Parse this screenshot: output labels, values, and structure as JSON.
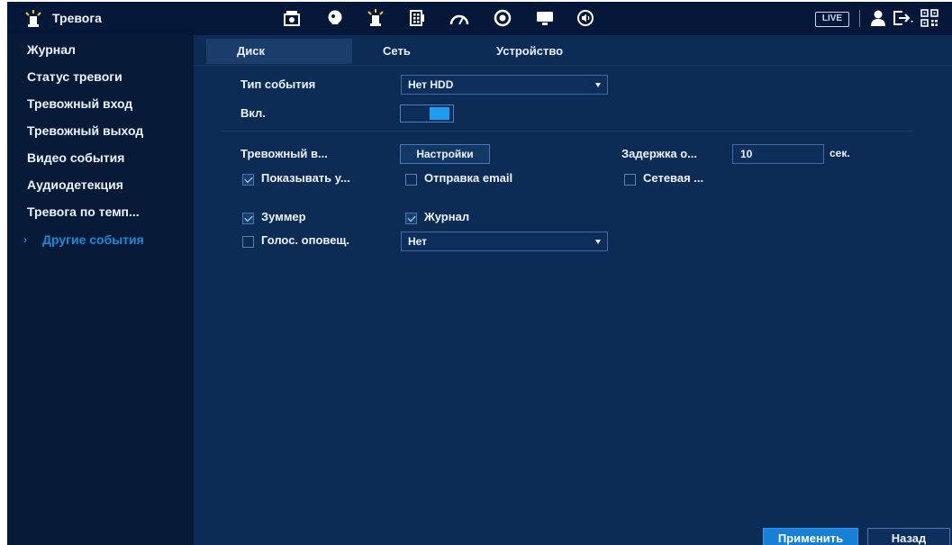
{
  "app": {
    "title": "Тревога"
  },
  "toolbar": {
    "icons": [
      "camera-config-icon",
      "ai-face-icon",
      "alarm-icon",
      "storage-icon",
      "speed-gauge-icon",
      "record-ring-icon",
      "display-icon",
      "audio-icon"
    ],
    "live_label": "LIVE",
    "right_icons": [
      "user-icon",
      "logout-icon",
      "qr-code-icon"
    ]
  },
  "sidebar": {
    "items": [
      {
        "label": "Журнал"
      },
      {
        "label": "Статус тревоги"
      },
      {
        "label": "Тревожный вход"
      },
      {
        "label": "Тревожный выход"
      },
      {
        "label": "Видео события"
      },
      {
        "label": "Аудиодетекция"
      },
      {
        "label": "Тревога по темп..."
      },
      {
        "label": "Другие события",
        "active": true
      }
    ]
  },
  "tabs": [
    {
      "label": "Диск",
      "active": true
    },
    {
      "label": "Сеть"
    },
    {
      "label": "Устройство"
    }
  ],
  "form": {
    "event_type_label": "Тип события",
    "event_type_value": "Нет HDD",
    "enable_label": "Вкл.",
    "enable_on": true,
    "alarm_out_label": "Тревожный в...",
    "settings_button": "Настройки",
    "delay_label": "Задержка о...",
    "delay_value": "10",
    "delay_unit": "сек.",
    "show_msg_label": "Показывать у...",
    "show_msg_checked": true,
    "email_label": "Отправка email",
    "email_checked": false,
    "network_label": "Сетевая ...",
    "network_checked": false,
    "buzzer_label": "Зуммер",
    "buzzer_checked": true,
    "log_label": "Журнал",
    "log_checked": true,
    "voice_label": "Голос. оповещ.",
    "voice_checked": false,
    "voice_value": "Нет"
  },
  "footer": {
    "apply_label": "Применить",
    "back_label": "Назад"
  },
  "colors": {
    "background": "#0c2b55",
    "sidebar": "#071a38",
    "topbar": "#05183a",
    "accent": "#1a8ad8",
    "apply": "#1780d6"
  }
}
